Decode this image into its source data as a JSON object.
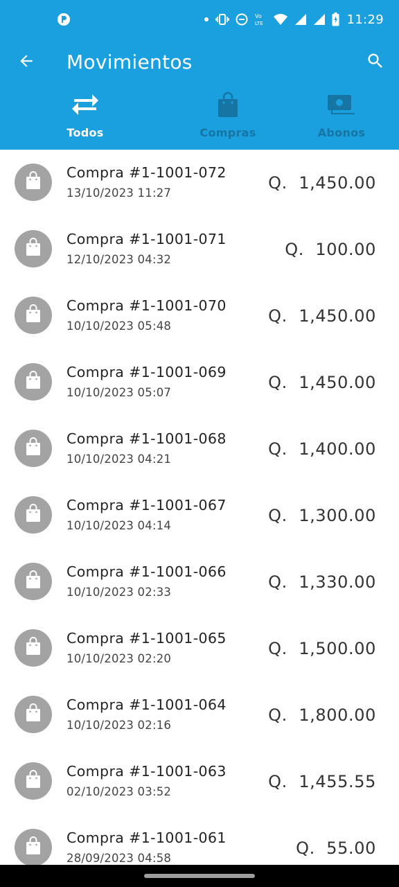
{
  "status_bar": {
    "time": "11:29",
    "icons": [
      "notification-dot-icon",
      "vibrate-icon",
      "do-not-disturb-icon",
      "volte-icon",
      "wifi-icon",
      "signal-icon",
      "signal-icon",
      "battery-icon"
    ]
  },
  "app_bar": {
    "title": "Movimientos",
    "back_icon": "arrow-back-icon",
    "search_icon": "search-icon"
  },
  "tabs": [
    {
      "label": "Todos",
      "icon": "swap-arrows-icon",
      "active": true
    },
    {
      "label": "Compras",
      "icon": "shopping-bag-icon",
      "active": false
    },
    {
      "label": "Abonos",
      "icon": "money-icon",
      "active": false
    }
  ],
  "colors": {
    "header": "#1aa0df",
    "inactive_tab": "#1675a3",
    "avatar": "#a3a3a3"
  },
  "transactions": [
    {
      "title": "Compra #1-1001-072",
      "date": "13/10/2023 11:27",
      "currency": "Q.",
      "amount": "1,450.00"
    },
    {
      "title": "Compra #1-1001-071",
      "date": "12/10/2023 04:32",
      "currency": "Q.",
      "amount": "100.00"
    },
    {
      "title": "Compra #1-1001-070",
      "date": "10/10/2023 05:48",
      "currency": "Q.",
      "amount": "1,450.00"
    },
    {
      "title": "Compra #1-1001-069",
      "date": "10/10/2023 05:07",
      "currency": "Q.",
      "amount": "1,450.00"
    },
    {
      "title": "Compra #1-1001-068",
      "date": "10/10/2023 04:21",
      "currency": "Q.",
      "amount": "1,400.00"
    },
    {
      "title": "Compra #1-1001-067",
      "date": "10/10/2023 04:14",
      "currency": "Q.",
      "amount": "1,300.00"
    },
    {
      "title": "Compra #1-1001-066",
      "date": "10/10/2023 02:33",
      "currency": "Q.",
      "amount": "1,330.00"
    },
    {
      "title": "Compra #1-1001-065",
      "date": "10/10/2023 02:20",
      "currency": "Q.",
      "amount": "1,500.00"
    },
    {
      "title": "Compra #1-1001-064",
      "date": "10/10/2023 02:16",
      "currency": "Q.",
      "amount": "1,800.00"
    },
    {
      "title": "Compra #1-1001-063",
      "date": "02/10/2023 03:52",
      "currency": "Q.",
      "amount": "1,455.55"
    },
    {
      "title": "Compra #1-1001-061",
      "date": "28/09/2023 04:58",
      "currency": "Q.",
      "amount": "55.00"
    }
  ]
}
